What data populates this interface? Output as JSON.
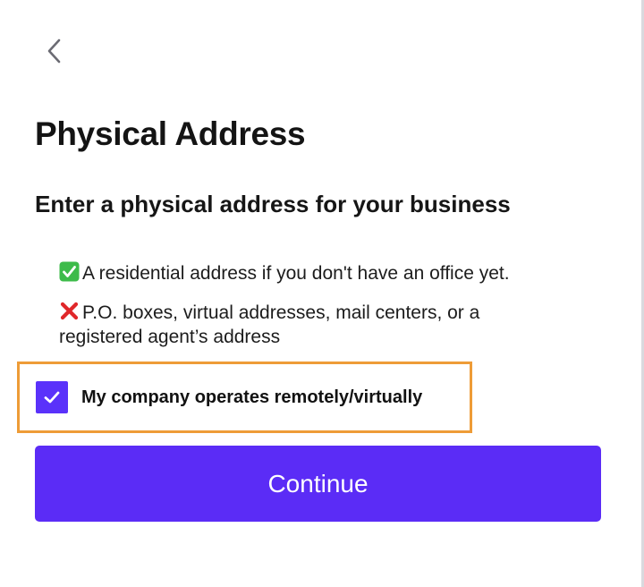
{
  "navigation": {
    "back_icon": "chevron-left-icon"
  },
  "header": {
    "title": "Physical Address",
    "subtitle": "Enter a physical address for your business"
  },
  "rules": {
    "allowed": {
      "icon": "green-check-emoji",
      "text": "A residential address if you don't have an office yet."
    },
    "not_allowed": {
      "icon": "red-cross-emoji",
      "text": "P.O. boxes, virtual addresses, mail centers, or a registered agent’s address"
    }
  },
  "remote_option": {
    "label": "My company operates remotely/virtually",
    "checked": true
  },
  "actions": {
    "continue_label": "Continue"
  },
  "colors": {
    "accent": "#5b2cf6",
    "highlight_border": "#ee9c37",
    "check_green": "#3dbb4a",
    "cross_red": "#e0272a"
  }
}
